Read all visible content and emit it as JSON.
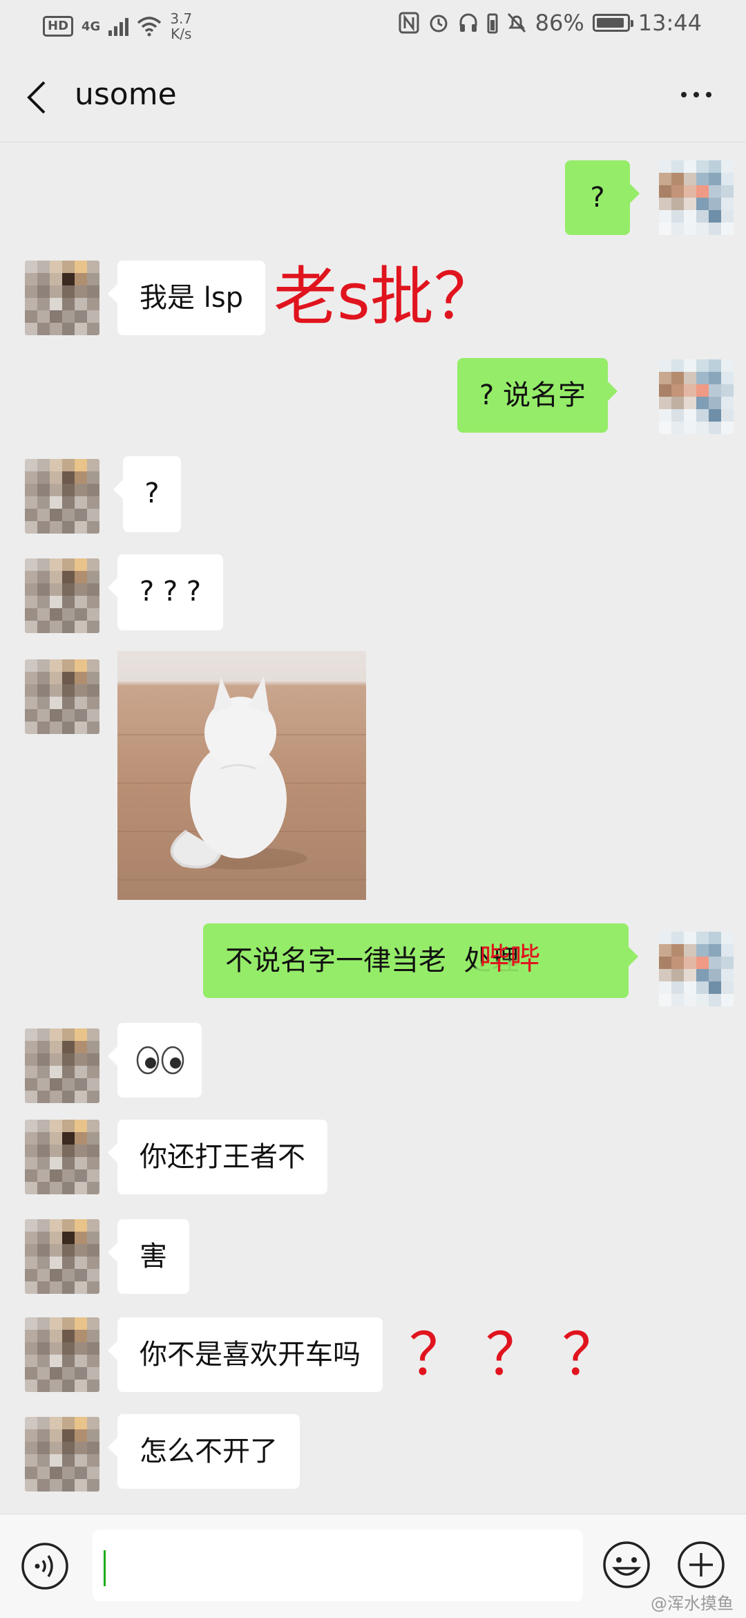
{
  "status_bar": {
    "hd": "HD",
    "network": "4G",
    "speed_value": "3.7",
    "speed_unit": "K/s",
    "battery": "86%",
    "time": "13:44"
  },
  "header": {
    "title": "usome"
  },
  "messages": [
    {
      "side": "out",
      "text": "?"
    },
    {
      "side": "in",
      "text": "我是 lsp"
    },
    {
      "side": "out",
      "text": "? 说名字"
    },
    {
      "side": "in",
      "text": "?"
    },
    {
      "side": "in",
      "text": "? ? ?"
    },
    {
      "side": "in",
      "image": "white-kitten-sticker"
    },
    {
      "side": "out",
      "text": "不说名字一律当老  处理"
    },
    {
      "side": "in",
      "text": "👀"
    },
    {
      "side": "in",
      "text": "你还打王者不"
    },
    {
      "side": "in",
      "text": "害"
    },
    {
      "side": "in",
      "text": "你不是喜欢开车吗"
    },
    {
      "side": "in",
      "text": "怎么不开了"
    }
  ],
  "annotations": {
    "lsp_note": "老s批？",
    "censor_word": "哔哔",
    "question_marks": "？ ？ ？"
  },
  "watermark": "@浑水摸鱼"
}
